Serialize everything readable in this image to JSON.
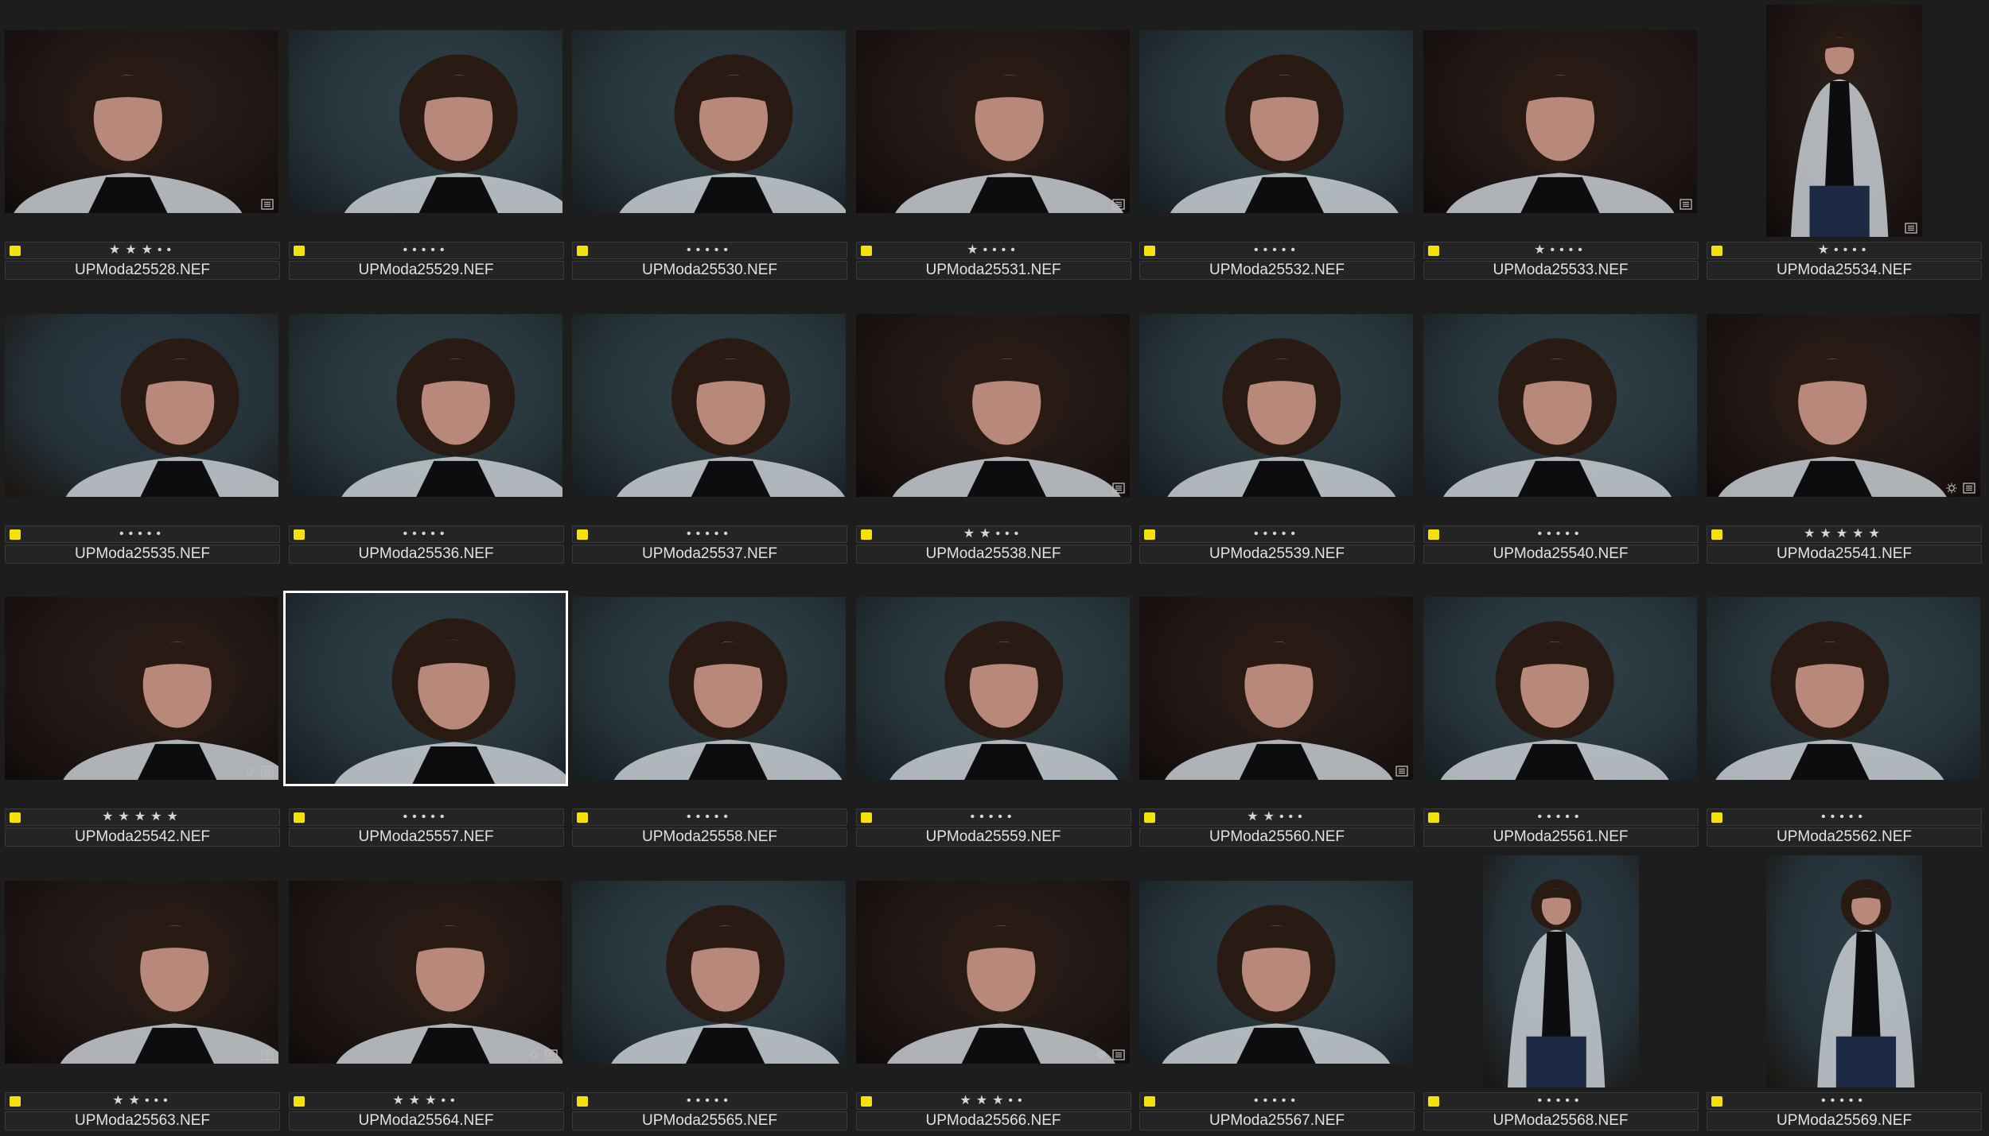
{
  "app": {
    "view": "thumbnail-grid",
    "label_color": "#f5e20d",
    "selection_color": "#ffffff"
  },
  "thumbnails": [
    {
      "filename": "UPModa25528.NEF",
      "rating": 3,
      "orientation": "landscape",
      "badges": [
        "metadata-icon"
      ],
      "selected": false,
      "tone": "warm"
    },
    {
      "filename": "UPModa25529.NEF",
      "rating": 0,
      "orientation": "landscape",
      "badges": [],
      "selected": false,
      "tone": "teal"
    },
    {
      "filename": "UPModa25530.NEF",
      "rating": 0,
      "orientation": "landscape",
      "badges": [],
      "selected": false,
      "tone": "teal"
    },
    {
      "filename": "UPModa25531.NEF",
      "rating": 1,
      "orientation": "landscape",
      "badges": [
        "metadata-icon"
      ],
      "selected": false,
      "tone": "warm"
    },
    {
      "filename": "UPModa25532.NEF",
      "rating": 0,
      "orientation": "landscape",
      "badges": [],
      "selected": false,
      "tone": "teal"
    },
    {
      "filename": "UPModa25533.NEF",
      "rating": 1,
      "orientation": "landscape",
      "badges": [
        "metadata-icon"
      ],
      "selected": false,
      "tone": "warm"
    },
    {
      "filename": "UPModa25534.NEF",
      "rating": 1,
      "orientation": "portrait",
      "badges": [
        "metadata-icon"
      ],
      "selected": false,
      "tone": "warm"
    },
    {
      "filename": "UPModa25535.NEF",
      "rating": 0,
      "orientation": "landscape",
      "badges": [],
      "selected": false,
      "tone": "studio"
    },
    {
      "filename": "UPModa25536.NEF",
      "rating": 0,
      "orientation": "landscape",
      "badges": [],
      "selected": false,
      "tone": "teal"
    },
    {
      "filename": "UPModa25537.NEF",
      "rating": 0,
      "orientation": "landscape",
      "badges": [],
      "selected": false,
      "tone": "teal"
    },
    {
      "filename": "UPModa25538.NEF",
      "rating": 2,
      "orientation": "landscape",
      "badges": [
        "metadata-icon"
      ],
      "selected": false,
      "tone": "warm"
    },
    {
      "filename": "UPModa25539.NEF",
      "rating": 0,
      "orientation": "landscape",
      "badges": [],
      "selected": false,
      "tone": "teal"
    },
    {
      "filename": "UPModa25540.NEF",
      "rating": 0,
      "orientation": "landscape",
      "badges": [],
      "selected": false,
      "tone": "teal"
    },
    {
      "filename": "UPModa25541.NEF",
      "rating": 5,
      "orientation": "landscape",
      "badges": [
        "adjust-icon",
        "metadata-icon"
      ],
      "selected": false,
      "tone": "warm"
    },
    {
      "filename": "UPModa25542.NEF",
      "rating": 5,
      "orientation": "landscape",
      "badges": [
        "adjust-icon",
        "metadata-icon"
      ],
      "selected": false,
      "tone": "warm"
    },
    {
      "filename": "UPModa25557.NEF",
      "rating": 0,
      "orientation": "landscape",
      "badges": [],
      "selected": true,
      "tone": "teal"
    },
    {
      "filename": "UPModa25558.NEF",
      "rating": 0,
      "orientation": "landscape",
      "badges": [],
      "selected": false,
      "tone": "teal"
    },
    {
      "filename": "UPModa25559.NEF",
      "rating": 0,
      "orientation": "landscape",
      "badges": [],
      "selected": false,
      "tone": "teal"
    },
    {
      "filename": "UPModa25560.NEF",
      "rating": 2,
      "orientation": "landscape",
      "badges": [
        "metadata-icon"
      ],
      "selected": false,
      "tone": "warm"
    },
    {
      "filename": "UPModa25561.NEF",
      "rating": 0,
      "orientation": "landscape",
      "badges": [],
      "selected": false,
      "tone": "teal"
    },
    {
      "filename": "UPModa25562.NEF",
      "rating": 0,
      "orientation": "landscape",
      "badges": [],
      "selected": false,
      "tone": "teal"
    },
    {
      "filename": "UPModa25563.NEF",
      "rating": 2,
      "orientation": "landscape",
      "badges": [
        "metadata-icon"
      ],
      "selected": false,
      "tone": "warm"
    },
    {
      "filename": "UPModa25564.NEF",
      "rating": 3,
      "orientation": "landscape",
      "badges": [
        "adjust-icon",
        "metadata-icon"
      ],
      "selected": false,
      "tone": "warm"
    },
    {
      "filename": "UPModa25565.NEF",
      "rating": 0,
      "orientation": "landscape",
      "badges": [],
      "selected": false,
      "tone": "teal"
    },
    {
      "filename": "UPModa25566.NEF",
      "rating": 3,
      "orientation": "landscape",
      "badges": [
        "adjust-icon",
        "metadata-icon"
      ],
      "selected": false,
      "tone": "warm"
    },
    {
      "filename": "UPModa25567.NEF",
      "rating": 0,
      "orientation": "landscape",
      "badges": [],
      "selected": false,
      "tone": "teal"
    },
    {
      "filename": "UPModa25568.NEF",
      "rating": 0,
      "orientation": "portrait",
      "badges": [],
      "selected": false,
      "tone": "studio"
    },
    {
      "filename": "UPModa25569.NEF",
      "rating": 0,
      "orientation": "portrait",
      "badges": [],
      "selected": false,
      "tone": "studio"
    }
  ]
}
